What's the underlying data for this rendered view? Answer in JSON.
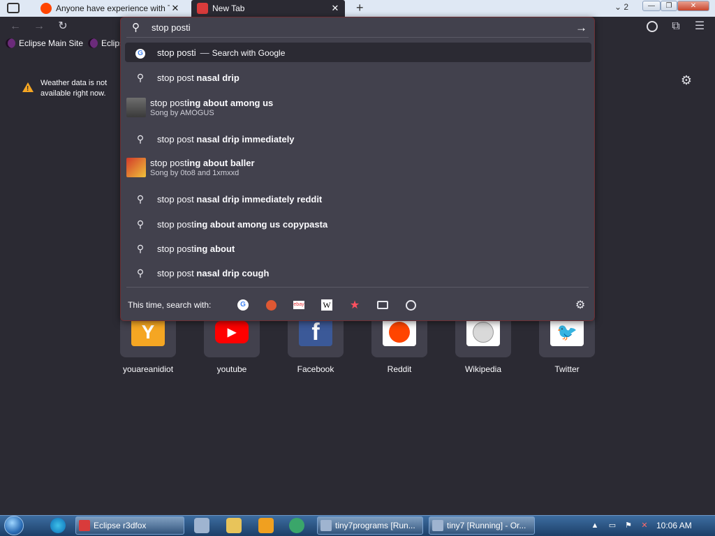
{
  "tabs": [
    {
      "title": "Anyone have experience with Ti",
      "active": false
    },
    {
      "title": "New Tab",
      "active": true
    }
  ],
  "tab_count": "2",
  "window_controls": {
    "minimize": "—",
    "maximize": "❐",
    "close": "✕"
  },
  "new_tab": "+",
  "toolbar": {
    "back": "←",
    "forward": "→",
    "reload": "↻"
  },
  "bookmarks": [
    {
      "label": "Eclipse Main Site"
    },
    {
      "label": "Eclips"
    }
  ],
  "urlbar": {
    "value": "stop posti"
  },
  "suggestions": [
    {
      "prefix": "stop posti",
      "bold": "",
      "action": "Search with Google",
      "kind": "google"
    },
    {
      "prefix": "stop post ",
      "bold": "nasal drip",
      "kind": "search"
    },
    {
      "prefix": "stop post",
      "bold": "ing about among us",
      "sub": "Song by AMOGUS",
      "kind": "song"
    },
    {
      "prefix": "stop post ",
      "bold": "nasal drip immediately",
      "kind": "search"
    },
    {
      "prefix": "stop post",
      "bold": "ing about baller",
      "sub": "Song by 0to8 and 1xmxxd",
      "kind": "song"
    },
    {
      "prefix": "stop post ",
      "bold": "nasal drip immediately reddit",
      "kind": "search"
    },
    {
      "prefix": "stop post",
      "bold": "ing about among us copypasta",
      "kind": "search"
    },
    {
      "prefix": "stop post",
      "bold": "ing about",
      "kind": "search"
    },
    {
      "prefix": "stop post ",
      "bold": "nasal drip cough",
      "kind": "search"
    }
  ],
  "one_off": {
    "label": "This time, search with:"
  },
  "weather": {
    "line1": "Weather data is not",
    "line2": "available right now."
  },
  "top_sites": [
    {
      "label": "youareanidiot",
      "color": "#f5a623"
    },
    {
      "label": "youtube",
      "color": "#ff0000"
    },
    {
      "label": "Facebook",
      "color": "#3b5998"
    },
    {
      "label": "Reddit",
      "color": "#ff4500"
    },
    {
      "label": "Wikipedia",
      "color": "#ffffff"
    },
    {
      "label": "Twitter",
      "color": "#1da1f2"
    }
  ],
  "taskbar": {
    "items": [
      {
        "label": "Eclipse r3dfox"
      },
      {
        "label": "tiny7programs [Run..."
      },
      {
        "label": "tiny7 [Running] - Or..."
      }
    ],
    "clock": "10:06 AM"
  }
}
